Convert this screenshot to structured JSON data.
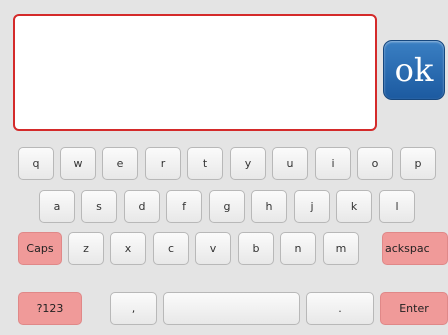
{
  "ok_label": "ok",
  "text_value": "",
  "colors": {
    "special_key": "#f09a99",
    "ok_button": "#2766ad",
    "text_area_border": "#d42a2a"
  },
  "keys": {
    "q": "q",
    "w": "w",
    "e": "e",
    "r": "r",
    "t": "t",
    "y": "y",
    "u": "u",
    "i": "i",
    "o": "o",
    "p": "p",
    "a": "a",
    "s": "s",
    "d": "d",
    "f": "f",
    "g": "g",
    "h": "h",
    "j": "j",
    "k": "k",
    "l": "l",
    "caps": "Caps",
    "z": "z",
    "x": "x",
    "c": "c",
    "v": "v",
    "b": "b",
    "n": "n",
    "m": "m",
    "backspace": "ackspac",
    "numbers": "?123",
    "comma": ",",
    "space": "",
    "period": ".",
    "enter": "Enter"
  }
}
